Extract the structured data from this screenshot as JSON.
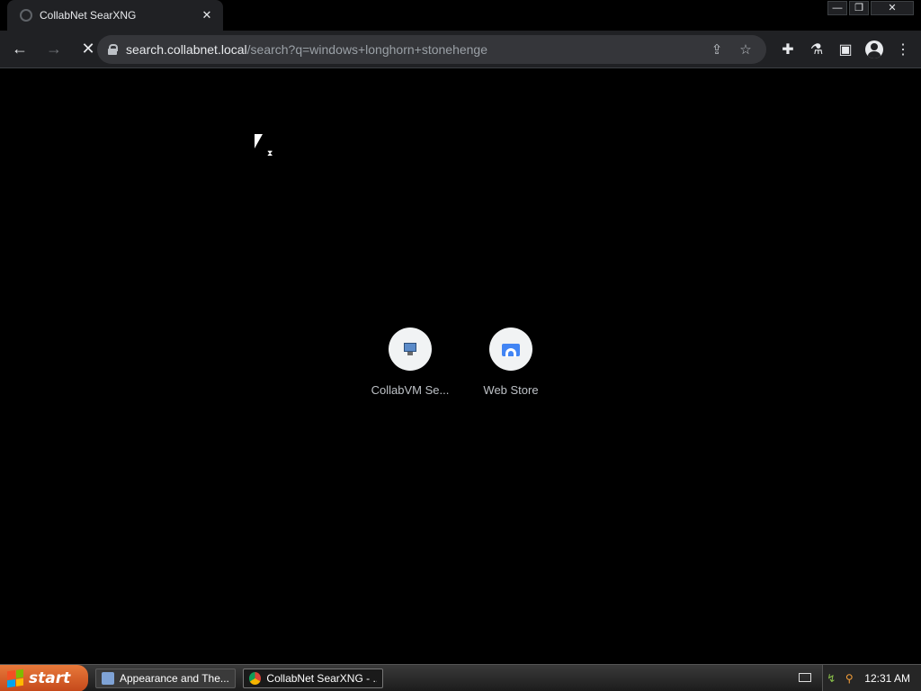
{
  "tab": {
    "title": "CollabNet SearXNG",
    "close": "✕"
  },
  "window_controls": {
    "minimize": "—",
    "restore": "❐",
    "close": "✕"
  },
  "toolbar": {
    "back": "←",
    "forward": "→",
    "stop": "✕",
    "url_host": "search.collabnet.local",
    "url_rest": "/search?q=windows+longhorn+stonehenge",
    "share": "⇪",
    "bookmark": "☆",
    "extensions": "✚",
    "labs": "⚗",
    "sidepanel": "▣",
    "menu": "⋮"
  },
  "shortcuts": [
    {
      "label": "CollabVM Se...",
      "icon": "collabvm-icon"
    },
    {
      "label": "Web Store",
      "icon": "web-store-icon"
    }
  ],
  "taskbar": {
    "start_label": "start",
    "tasks": [
      {
        "label": "Appearance and The...",
        "active": false
      },
      {
        "label": "CollabNet SearXNG - ...",
        "active": true
      }
    ],
    "clock": "12:31 AM"
  }
}
